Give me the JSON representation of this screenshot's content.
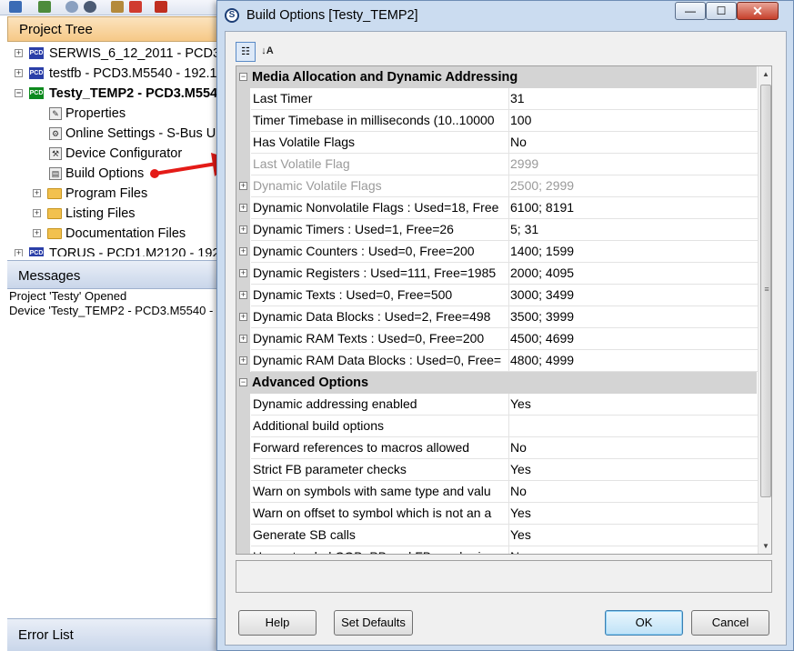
{
  "background": {
    "project_tree": {
      "title": "Project Tree",
      "nodes": [
        {
          "label": "SERWIS_6_12_2011 - PCD3.M",
          "icon": "pcd-device-icon"
        },
        {
          "label": "testfb - PCD3.M5540 - 192.1",
          "icon": "pcd-device-icon"
        },
        {
          "label": "Testy_TEMP2 - PCD3.M554",
          "icon": "pcd-device-active-icon"
        },
        {
          "label": "Properties",
          "icon": "properties-icon"
        },
        {
          "label": "Online Settings - S-Bus U",
          "icon": "online-settings-icon"
        },
        {
          "label": "Device Configurator",
          "icon": "device-configurator-icon"
        },
        {
          "label": "Build Options",
          "icon": "build-options-icon"
        },
        {
          "label": "Program Files",
          "icon": "folder-icon"
        },
        {
          "label": "Listing Files",
          "icon": "folder-icon"
        },
        {
          "label": "Documentation Files",
          "icon": "folder-icon"
        },
        {
          "label": "TORUS - PCD1.M2120 - 192",
          "icon": "pcd-device-icon"
        }
      ]
    },
    "messages": {
      "title": "Messages",
      "lines": [
        "Project 'Testy' Opened",
        "Device 'Testy_TEMP2 - PCD3.M5540 -"
      ]
    },
    "error_list": {
      "title": "Error List"
    }
  },
  "dialog": {
    "title": "Build Options [Testy_TEMP2]",
    "caption_buttons": {
      "minimize": "—",
      "maximize": "☐",
      "close": "✕"
    },
    "categories": [
      {
        "name": "Media Allocation and Dynamic Addressing",
        "rows": [
          {
            "name": "Last Timer",
            "value": "31",
            "expandable": false,
            "disabled": false
          },
          {
            "name": "Timer Timebase in milliseconds (10..10000",
            "value": "100",
            "expandable": false,
            "disabled": false
          },
          {
            "name": "Has Volatile Flags",
            "value": "No",
            "expandable": false,
            "disabled": false
          },
          {
            "name": "Last Volatile Flag",
            "value": "2999",
            "expandable": false,
            "disabled": true
          },
          {
            "name": "Dynamic Volatile Flags",
            "value": "2500; 2999",
            "expandable": true,
            "disabled": true
          },
          {
            "name": "Dynamic Nonvolatile Flags : Used=18, Free",
            "value": "6100; 8191",
            "expandable": true,
            "disabled": false
          },
          {
            "name": "Dynamic Timers : Used=1, Free=26",
            "value": "5; 31",
            "expandable": true,
            "disabled": false
          },
          {
            "name": "Dynamic Counters : Used=0, Free=200",
            "value": "1400; 1599",
            "expandable": true,
            "disabled": false
          },
          {
            "name": "Dynamic Registers : Used=111, Free=1985",
            "value": "2000; 4095",
            "expandable": true,
            "disabled": false
          },
          {
            "name": "Dynamic Texts : Used=0, Free=500",
            "value": "3000; 3499",
            "expandable": true,
            "disabled": false
          },
          {
            "name": "Dynamic Data Blocks : Used=2, Free=498",
            "value": "3500; 3999",
            "expandable": true,
            "disabled": false
          },
          {
            "name": "Dynamic RAM Texts : Used=0, Free=200",
            "value": "4500; 4699",
            "expandable": true,
            "disabled": false
          },
          {
            "name": "Dynamic RAM Data Blocks : Used=0, Free=",
            "value": "4800; 4999",
            "expandable": true,
            "disabled": false
          }
        ]
      },
      {
        "name": "Advanced Options",
        "rows": [
          {
            "name": "Dynamic addressing enabled",
            "value": "Yes",
            "expandable": false,
            "disabled": false
          },
          {
            "name": "Additional build options",
            "value": "",
            "expandable": false,
            "disabled": false
          },
          {
            "name": "Forward references to macros allowed",
            "value": "No",
            "expandable": false,
            "disabled": false
          },
          {
            "name": "Strict FB parameter checks",
            "value": "Yes",
            "expandable": false,
            "disabled": false
          },
          {
            "name": "Warn on symbols with same type and valu",
            "value": "No",
            "expandable": false,
            "disabled": false
          },
          {
            "name": "Warn on offset to symbol which is not an a",
            "value": "Yes",
            "expandable": false,
            "disabled": false
          },
          {
            "name": "Generate SB calls",
            "value": "Yes",
            "expandable": false,
            "disabled": false
          },
          {
            "name": "Use extended COB, PB and FB numbering",
            "value": "No",
            "expandable": false,
            "disabled": false
          }
        ]
      }
    ],
    "buttons": {
      "help": "Help",
      "set_defaults": "Set Defaults",
      "ok": "OK",
      "cancel": "Cancel"
    }
  },
  "colors": {
    "highlight_arrow": "#e41b17",
    "category_bg": "#d4d4d4",
    "dialog_frame": "#cbdcf0"
  }
}
